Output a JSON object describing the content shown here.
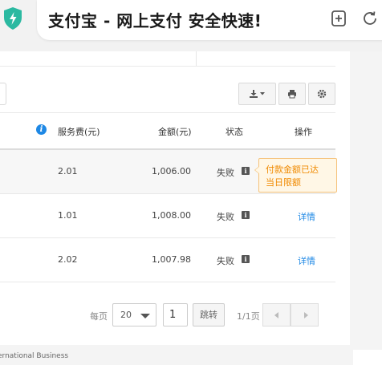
{
  "browser": {
    "page_title": "支付宝 - 网上支付 安全快速!",
    "icons": [
      "shield-bolt-icon",
      "bookmark-add-icon",
      "refresh-icon"
    ]
  },
  "toolbar": {
    "icons": [
      "download-icon",
      "print-icon",
      "settings-icon"
    ]
  },
  "table": {
    "headers": {
      "fee": "服务费(元)",
      "amount": "金额(元)",
      "status": "状态",
      "action": "操作"
    },
    "rows": [
      {
        "fee": "2.01",
        "amount": "1,006.00",
        "status": "失败",
        "action": ""
      },
      {
        "fee": "1.01",
        "amount": "1,008.00",
        "status": "失败",
        "action": "详情"
      },
      {
        "fee": "2.02",
        "amount": "1,007.98",
        "status": "失败",
        "action": "详情"
      }
    ],
    "tooltip": {
      "line1": "付款金额已达",
      "line2": "当日限额"
    }
  },
  "pager": {
    "per_page_label": "每页",
    "page_size": "20",
    "page_input": "1",
    "jump_label": "跳转",
    "page_info": "1/1页"
  },
  "footer": {
    "text": "ernational Business"
  },
  "colors": {
    "accent": "#1e88e5",
    "warning": "#f08a00",
    "shield": "#2bb9a1"
  }
}
